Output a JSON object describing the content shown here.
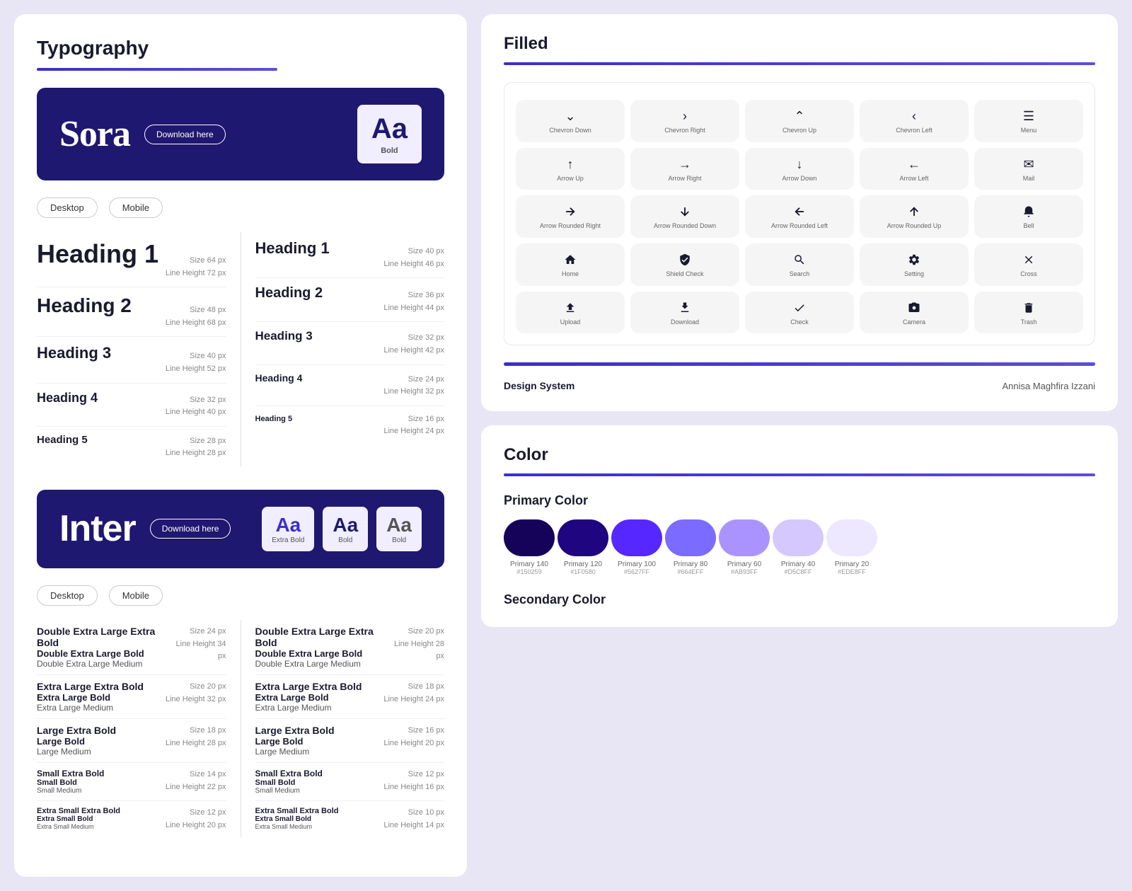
{
  "typography": {
    "title": "Typography",
    "sora": {
      "name": "Sora",
      "download_label": "Download here",
      "preview": "Aa",
      "preview_label": "Bold",
      "desktop_tab": "Desktop",
      "mobile_tab": "Mobile",
      "desktop_headings": [
        {
          "name": "Heading 1",
          "size": "Size 64 px",
          "line_height": "Line Height 72 px",
          "class": "h1"
        },
        {
          "name": "Heading 2",
          "size": "Size 48 px",
          "line_height": "Line Height 68 px",
          "class": "h2"
        },
        {
          "name": "Heading 3",
          "size": "Size 40 px",
          "line_height": "Line Height 52 px",
          "class": "h3"
        },
        {
          "name": "Heading 4",
          "size": "Size 32 px",
          "line_height": "Line Height 40 px",
          "class": "h4"
        },
        {
          "name": "Heading 5",
          "size": "Size 28 px",
          "line_height": "Line Height 28 px",
          "class": "h5"
        }
      ],
      "mobile_headings": [
        {
          "name": "Heading 1",
          "size": "Size 40 px",
          "line_height": "Line Height 46 px",
          "class": "mh1"
        },
        {
          "name": "Heading 2",
          "size": "Size 36 px",
          "line_height": "Line Height 44 px",
          "class": "mh2"
        },
        {
          "name": "Heading 3",
          "size": "Size 32 px",
          "line_height": "Line Height 42 px",
          "class": "mh3"
        },
        {
          "name": "Heading 4",
          "size": "Size 24 px",
          "line_height": "Line Height 32 px",
          "class": "mh4"
        },
        {
          "name": "Heading 5",
          "size": "Size 16 px",
          "line_height": "Line Height 24 px",
          "class": "mh5"
        }
      ]
    },
    "inter": {
      "name": "Inter",
      "download_label": "Download here",
      "previews": [
        {
          "aa": "Aa",
          "label": "Extra Bold",
          "weight": "extra"
        },
        {
          "aa": "Aa",
          "label": "Bold",
          "weight": "bold"
        },
        {
          "aa": "Aa",
          "label": "Bold",
          "weight": "regular"
        }
      ],
      "desktop_tab": "Desktop",
      "mobile_tab": "Mobile",
      "desktop_rows": [
        {
          "extrabold": "Double Extra Large Extra Bold",
          "bold": "Double Extra Large Bold",
          "medium": "Double Extra Large Medium",
          "size": "Size 24 px",
          "line_height": "Line Height 34 px"
        },
        {
          "extrabold": "Extra Large Extra Bold",
          "bold": "Extra Large Bold",
          "medium": "Extra Large Medium",
          "size": "Size 20 px",
          "line_height": "Line Height 32 px"
        },
        {
          "extrabold": "Large Extra Bold",
          "bold": "Large Bold",
          "medium": "Large Medium",
          "size": "Size 18 px",
          "line_height": "Line Height 28 px"
        },
        {
          "extrabold": "Small Extra Bold",
          "bold": "Small Bold",
          "medium": "Small Medium",
          "size": "Size 14 px",
          "line_height": "Line Height 22 px"
        },
        {
          "extrabold": "Extra Small Extra Bold",
          "bold": "Extra Small Bold",
          "medium": "Extra Small Medium",
          "size": "Size 12 px",
          "line_height": "Line Height 20 px"
        }
      ],
      "mobile_rows": [
        {
          "extrabold": "Double Extra Large Extra Bold",
          "bold": "Double Extra Large Bold",
          "medium": "Double Extra Large Medium",
          "size": "Size 20 px",
          "line_height": "Line Height 28 px"
        },
        {
          "extrabold": "Extra Large Extra Bold",
          "bold": "Extra Large Bold",
          "medium": "Extra Large Medium",
          "size": "Size 18 px",
          "line_height": "Line Height 24 px"
        },
        {
          "extrabold": "Large Extra Bold",
          "bold": "Large Bold",
          "medium": "Large Medium",
          "size": "Size 16 px",
          "line_height": "Line Height 20 px"
        },
        {
          "extrabold": "Small Extra Bold",
          "bold": "Small Bold",
          "medium": "Small Medium",
          "size": "Size 12 px",
          "line_height": "Line Height 16 px"
        },
        {
          "extrabold": "Extra Small Extra Bold",
          "bold": "Extra Small Bold",
          "medium": "Extra Small Medium",
          "size": "Size 10 px",
          "line_height": "Line Height 14 px"
        }
      ]
    }
  },
  "icons": {
    "section_title": "Filled",
    "cells": [
      {
        "symbol": "∨",
        "label": "Chevron Down"
      },
      {
        "symbol": "›",
        "label": "Chevron Right"
      },
      {
        "symbol": "∧",
        "label": "Chevron Up"
      },
      {
        "symbol": "‹",
        "label": "Chevron Left"
      },
      {
        "symbol": "≡",
        "label": "Menu"
      },
      {
        "symbol": "↑",
        "label": "Arrow Up"
      },
      {
        "symbol": "→",
        "label": "Arrow Right"
      },
      {
        "symbol": "↓",
        "label": "Arrow Down"
      },
      {
        "symbol": "←",
        "label": "Arrow Left"
      },
      {
        "symbol": "✉",
        "label": "Mail"
      },
      {
        "symbol": "↻",
        "label": "Arrow Rounded Right"
      },
      {
        "symbol": "↺",
        "label": "Arrow Rounded Down"
      },
      {
        "symbol": "↶",
        "label": "Arrow Rounded Left"
      },
      {
        "symbol": "↷",
        "label": "Arrow Rounded Up"
      },
      {
        "symbol": "🔔",
        "label": "Bell"
      },
      {
        "symbol": "⌂",
        "label": "Home"
      },
      {
        "symbol": "🛡",
        "label": "Shield Check"
      },
      {
        "symbol": "🔍",
        "label": "Search"
      },
      {
        "symbol": "⚙",
        "label": "Setting"
      },
      {
        "symbol": "✕",
        "label": "Cross"
      },
      {
        "symbol": "⬆",
        "label": "Upload"
      },
      {
        "symbol": "⬇",
        "label": "Download"
      },
      {
        "symbol": "✓",
        "label": "Check"
      },
      {
        "symbol": "📷",
        "label": "Camera"
      },
      {
        "symbol": "🗑",
        "label": "Trash"
      }
    ],
    "footer": {
      "design_system": "Design System",
      "author": "Annisa Maghfira Izzani"
    }
  },
  "colors": {
    "section_title": "Color",
    "primary_title": "Primary Color",
    "primary_swatches": [
      {
        "name": "Primary 140",
        "hex": "#150259",
        "color": "#150259"
      },
      {
        "name": "Primary 120",
        "hex": "#1F0580",
        "color": "#1F0580"
      },
      {
        "name": "Primary 100",
        "hex": "#5627FF",
        "color": "#5627FF"
      },
      {
        "name": "Primary 80",
        "hex": "#664EFF",
        "color": "#7B6BFF"
      },
      {
        "name": "Primary 60",
        "hex": "#AB93FF",
        "color": "#AB93FF"
      },
      {
        "name": "Primary 40",
        "hex": "#D5C8FF",
        "color": "#D5C8FF"
      },
      {
        "name": "Primary 20",
        "hex": "#EDE8FF",
        "color": "#EDE8FF"
      }
    ],
    "secondary_title": "Secondary Color"
  }
}
